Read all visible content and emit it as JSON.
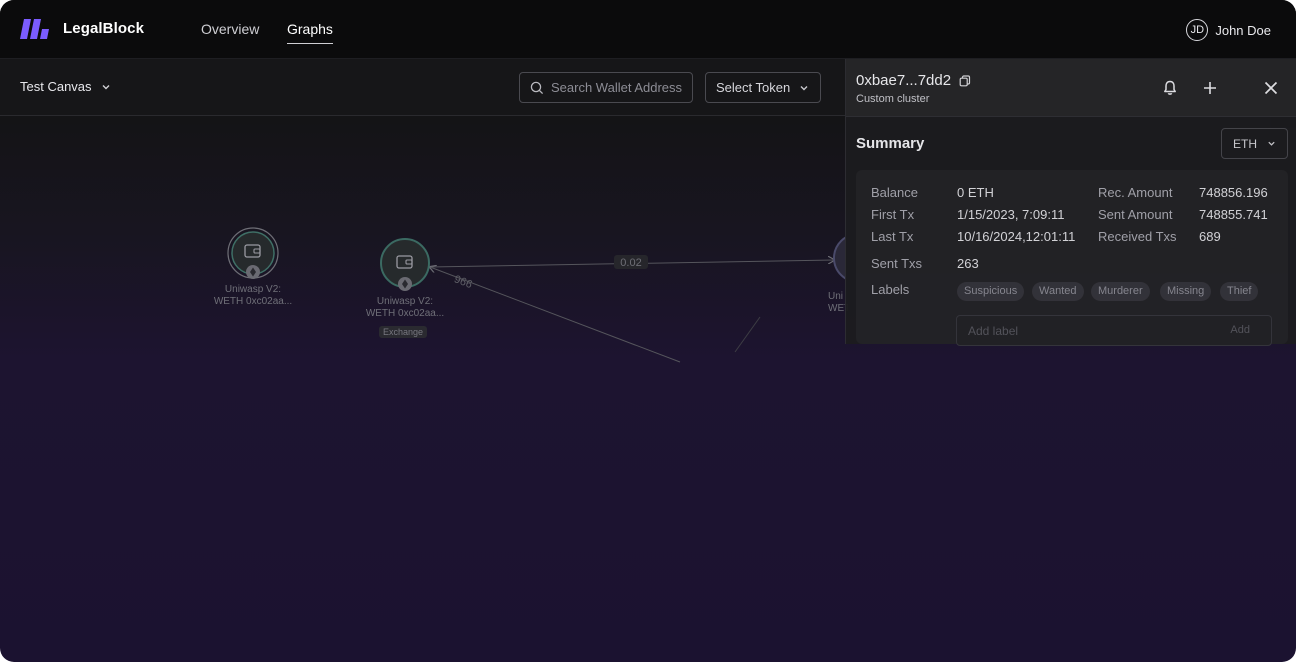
{
  "header": {
    "brand": "LegalBlock",
    "nav": [
      {
        "label": "Overview",
        "active": false
      },
      {
        "label": "Graphs",
        "active": true
      }
    ],
    "user": {
      "initials": "JD",
      "name": "John Doe"
    },
    "logo_color": "#7b5cff"
  },
  "toolbar": {
    "canvas_name": "Test Canvas",
    "search_placeholder": "Search Wallet Address",
    "token_select": "Select Token"
  },
  "graph": {
    "nodes": [
      {
        "line1": "Uniwasp V2:",
        "line2": "WETH 0xc02aa...",
        "badge": ""
      },
      {
        "line1": "Uniwasp V2:",
        "line2": "WETH 0xc02aa...",
        "badge": "Exchange"
      },
      {
        "line1": "Uni",
        "line2": "WETH",
        "badge": ""
      }
    ],
    "edges": [
      {
        "label": "0.02"
      },
      {
        "label": "966"
      }
    ]
  },
  "panel": {
    "address": "0xbae7...7dd2",
    "cluster": "Custom cluster",
    "summary_title": "Summary",
    "currency": "ETH",
    "fields": {
      "balance": {
        "label": "Balance",
        "value": "0 ETH"
      },
      "first_tx": {
        "label": "First Tx",
        "value": "1/15/2023, 7:09:11"
      },
      "last_tx": {
        "label": "Last Tx",
        "value": "10/16/2024,12:01:11"
      },
      "sent_txs": {
        "label": "Sent Txs",
        "value": "263"
      },
      "rec_amount": {
        "label": "Rec. Amount",
        "value": "748856.196"
      },
      "sent_amount": {
        "label": "Sent Amount",
        "value": "748855.741"
      },
      "received_txs": {
        "label": "Received Txs",
        "value": "689"
      }
    },
    "labels_title": "Labels",
    "tags": [
      "Suspicious",
      "Wanted",
      "Murderer",
      "Missing",
      "Thief"
    ],
    "label_placeholder": "Add label",
    "add_label": "Add"
  }
}
